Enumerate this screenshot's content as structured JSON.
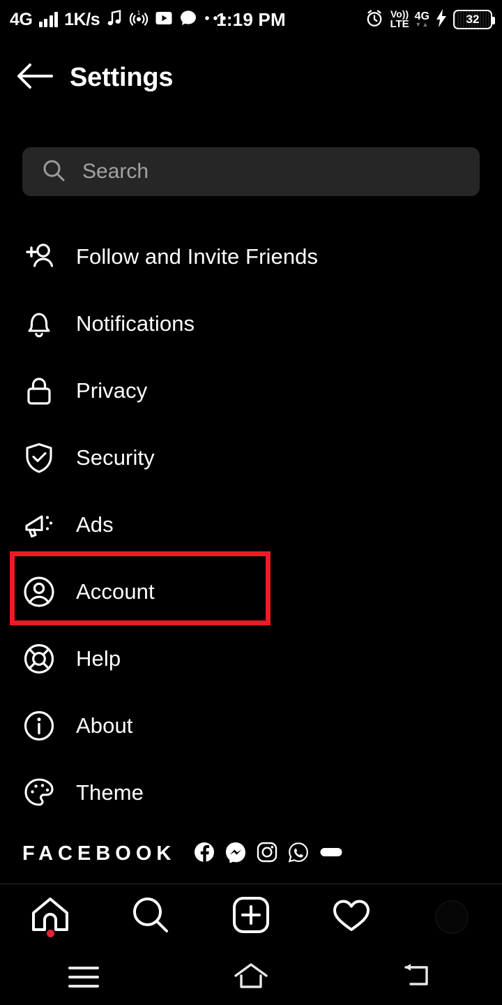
{
  "status_bar": {
    "network_label": "4G",
    "data_rate": "1K/s",
    "icons": [
      "music-note-icon",
      "cast-icon",
      "youtube-icon",
      "chat-bubble-icon",
      "more-dots-icon"
    ],
    "clock": "1:19 PM",
    "right_icons": [
      "alarm-icon",
      "volte-icon",
      "signal-4g-icon",
      "charging-bolt-icon"
    ],
    "volte_top": "Vo))",
    "volte_bottom": "LTE",
    "net_label": "4G",
    "net_sub": "▼▲",
    "battery_level": "32"
  },
  "header": {
    "back_icon": "arrow-left-icon",
    "title": "Settings"
  },
  "search": {
    "icon": "search-icon",
    "placeholder": "Search",
    "value": "",
    "background": "#262626"
  },
  "menu": {
    "items": [
      {
        "label": "Follow and Invite Friends",
        "icon": "person-add-icon"
      },
      {
        "label": "Notifications",
        "icon": "bell-icon"
      },
      {
        "label": "Privacy",
        "icon": "lock-icon"
      },
      {
        "label": "Security",
        "icon": "shield-check-icon"
      },
      {
        "label": "Ads",
        "icon": "megaphone-icon"
      },
      {
        "label": "Account",
        "icon": "account-circle-icon"
      },
      {
        "label": "Help",
        "icon": "lifebuoy-icon"
      },
      {
        "label": "About",
        "icon": "info-circle-icon"
      },
      {
        "label": "Theme",
        "icon": "palette-icon"
      }
    ]
  },
  "highlight": {
    "target_label": "Account",
    "color": "#ed1c24"
  },
  "facebook_section": {
    "label": "FACEBOOK",
    "app_icons": [
      "facebook-icon",
      "messenger-icon",
      "instagram-icon",
      "whatsapp-icon",
      "oculus-icon"
    ]
  },
  "bottom_nav": {
    "items": [
      {
        "icon": "home-icon",
        "badge": true
      },
      {
        "icon": "search-icon",
        "badge": false
      },
      {
        "icon": "add-post-icon",
        "badge": false
      },
      {
        "icon": "heart-icon",
        "badge": false
      },
      {
        "icon": "profile-avatar-icon",
        "badge": false
      }
    ],
    "badge_color": "#e1223a"
  },
  "android_nav": {
    "items": [
      {
        "icon": "recents-menu-icon"
      },
      {
        "icon": "home-outline-icon"
      },
      {
        "icon": "back-arrow-icon"
      }
    ]
  }
}
